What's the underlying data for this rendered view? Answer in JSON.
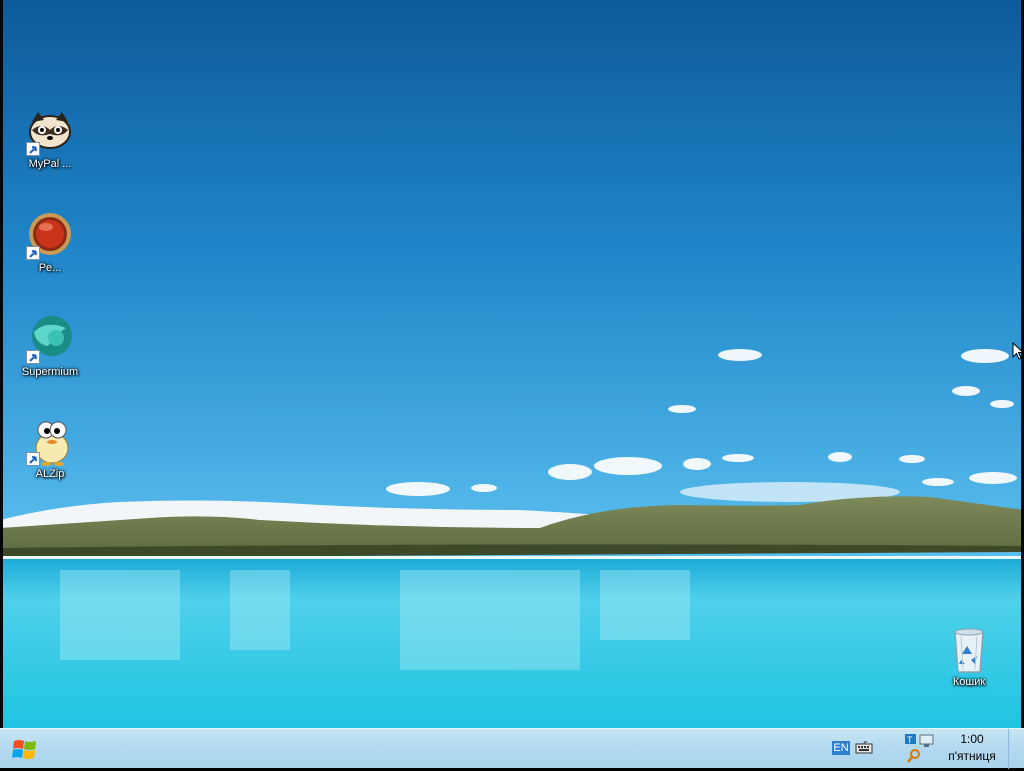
{
  "desktop": {
    "icons": [
      {
        "label": "MyPal ...",
        "icon": "raccoon-icon"
      },
      {
        "label": "Pe...",
        "icon": "red-orb-icon"
      },
      {
        "label": "Supermium",
        "icon": "supermium-icon"
      },
      {
        "label": "ALZip",
        "icon": "alzip-icon"
      }
    ],
    "recycle_bin": {
      "label": "Кошик",
      "icon": "recycle-bin-icon"
    }
  },
  "taskbar": {
    "start_icon": "windows-logo-icon",
    "language": "EN",
    "keyboard_icon": "keyboard-icon",
    "network_icon": "network-icon",
    "search_icon": "search-icon",
    "clock": {
      "time": "1:00",
      "day": "п'ятниця"
    }
  },
  "colors": {
    "sky_top": "#0e5a9b",
    "sky_bottom": "#5cc0ef",
    "water": "#21c8e3",
    "taskbar": "#b4daf0"
  }
}
